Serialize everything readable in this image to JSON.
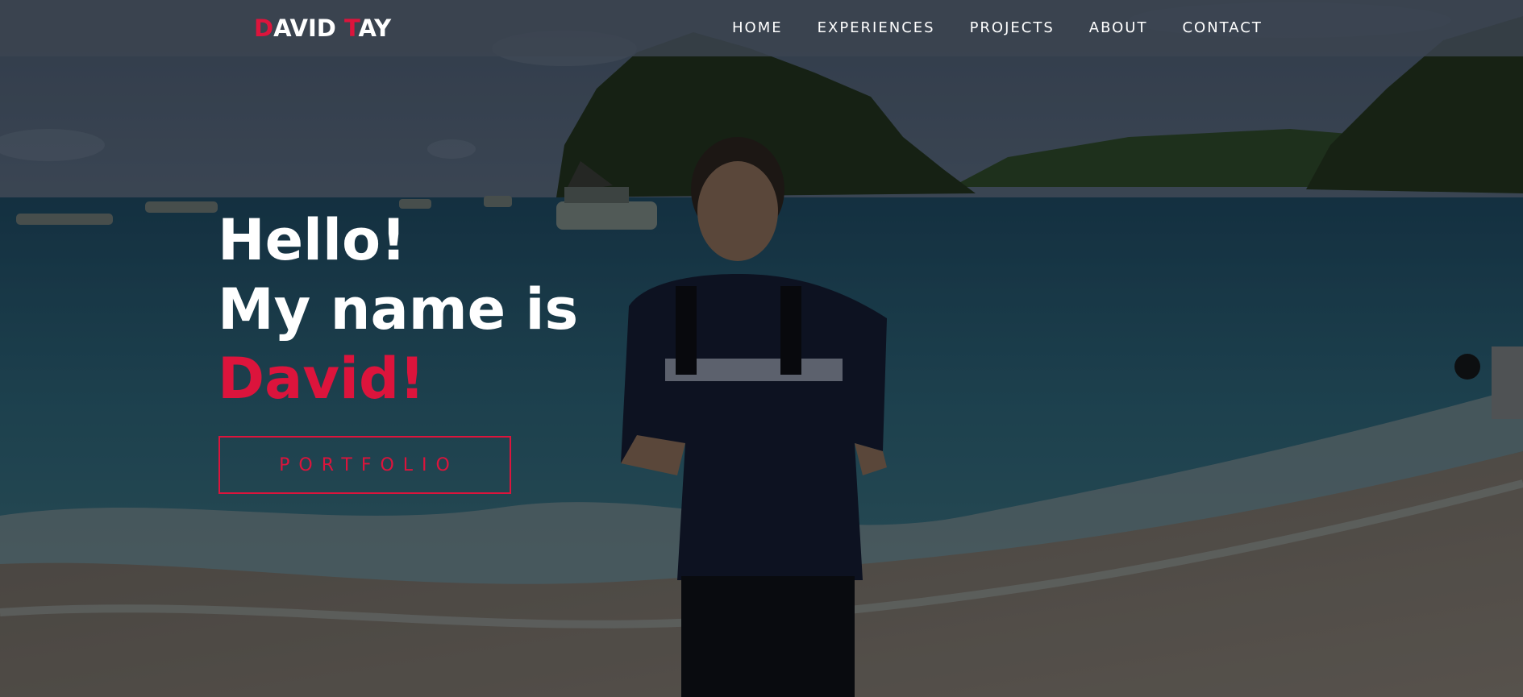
{
  "navbar": {
    "brand": {
      "first_initial": "D",
      "first_rest": "AVID ",
      "last_initial": "T",
      "last_rest": "AY"
    },
    "links": [
      {
        "label": "HOME"
      },
      {
        "label": "EXPERIENCES"
      },
      {
        "label": "PROJECTS"
      },
      {
        "label": "ABOUT"
      },
      {
        "label": "CONTACT"
      }
    ]
  },
  "hero": {
    "greeting": "Hello!",
    "intro": "My name is",
    "name": "David!",
    "cta_label": "PORTFOLIO"
  },
  "colors": {
    "accent": "#dc143c",
    "text": "#ffffff",
    "navbar_bg": "#3c4450"
  }
}
